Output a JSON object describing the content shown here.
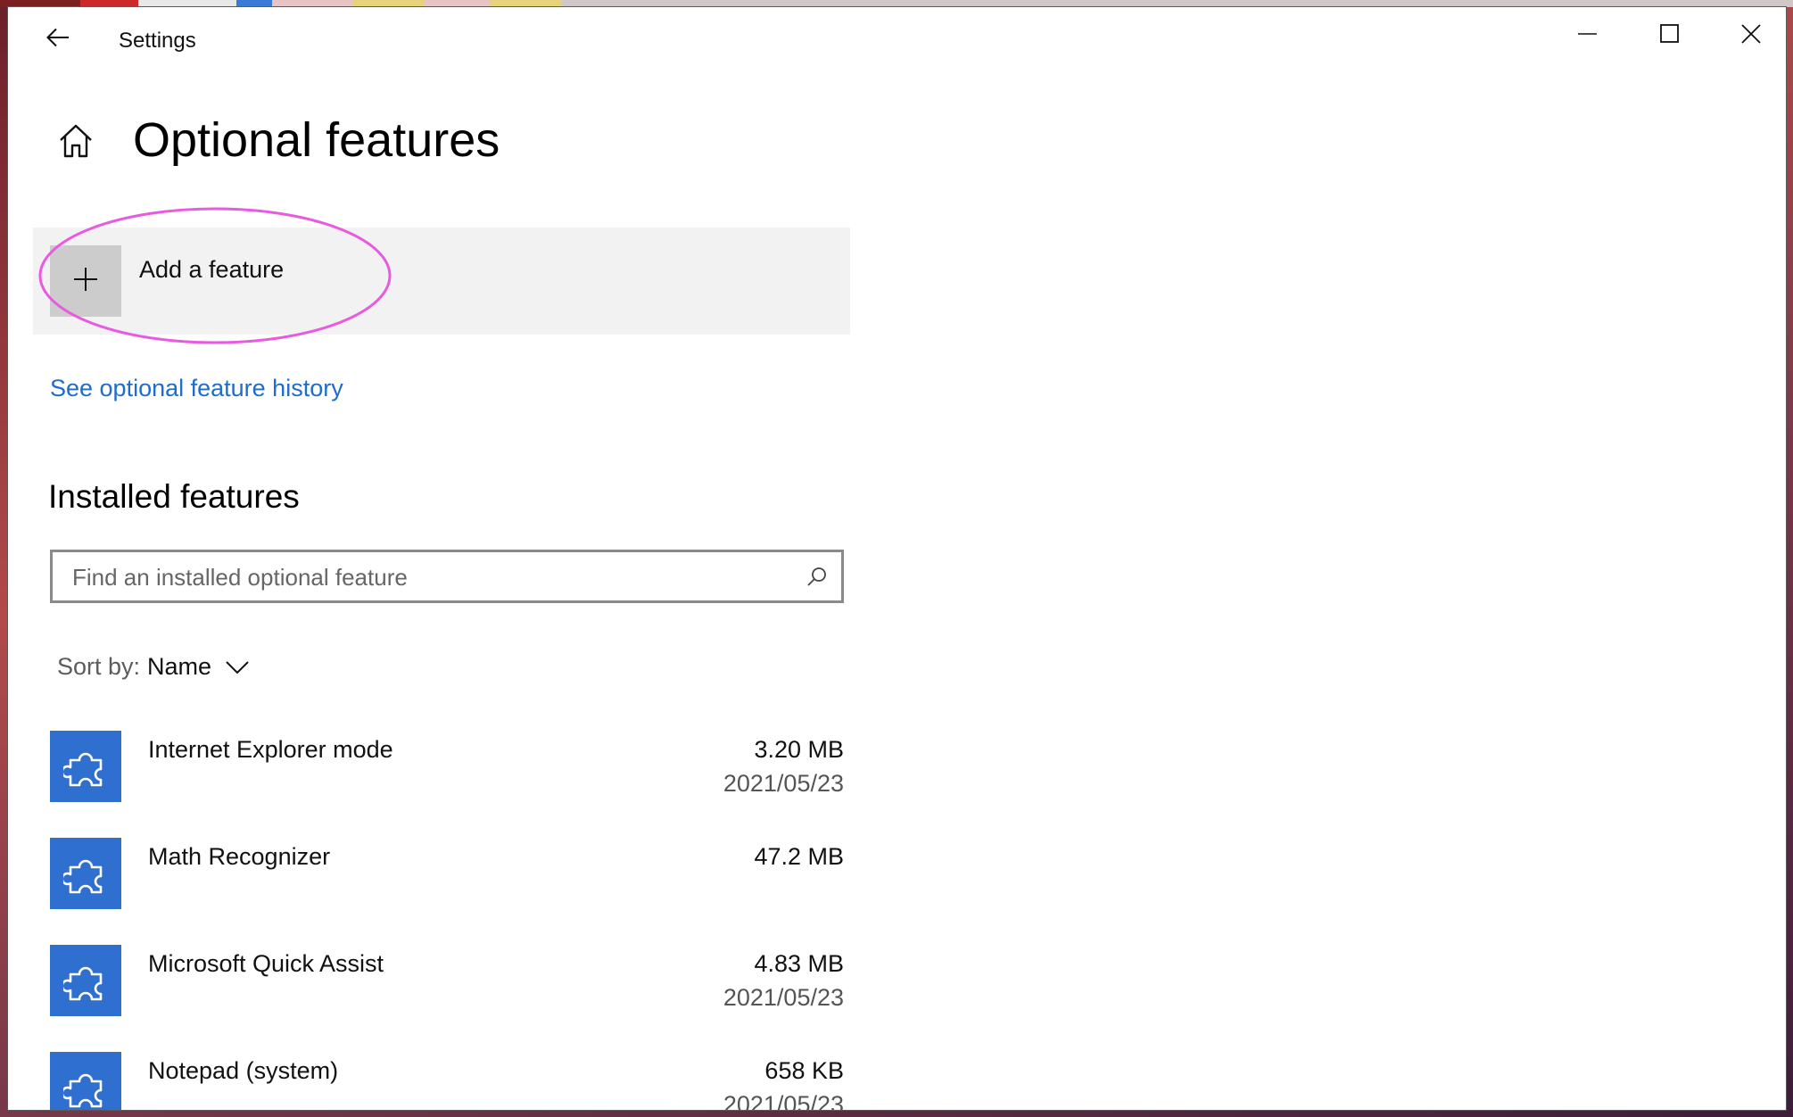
{
  "window": {
    "app_title": "Settings"
  },
  "page": {
    "title": "Optional features"
  },
  "add_feature": {
    "label": "Add a feature"
  },
  "history_link": {
    "label": "See optional feature history"
  },
  "installed": {
    "title": "Installed features",
    "search_placeholder": "Find an installed optional feature",
    "sort_label": "Sort by:",
    "sort_value": "Name",
    "items": [
      {
        "name": "Internet Explorer mode",
        "size": "3.20 MB",
        "date": "2021/05/23"
      },
      {
        "name": "Math Recognizer",
        "size": "47.2 MB",
        "date": ""
      },
      {
        "name": "Microsoft Quick Assist",
        "size": "4.83 MB",
        "date": "2021/05/23"
      },
      {
        "name": "Notepad (system)",
        "size": "658 KB",
        "date": "2021/05/23"
      }
    ]
  },
  "icons": {
    "back": "back-arrow-icon",
    "home": "home-icon",
    "add": "plus-icon",
    "search": "search-icon",
    "sort": "chevron-down-icon",
    "feature": "puzzle-piece-icon",
    "minimize": "minimize-icon",
    "maximize": "maximize-icon",
    "close": "close-icon"
  },
  "colors": {
    "accent": "#2f6fcf",
    "link": "#1e6ccb",
    "annotation": "#e85ae0"
  }
}
